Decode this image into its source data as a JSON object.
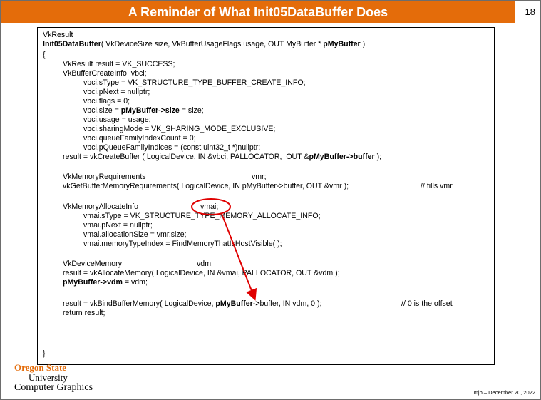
{
  "slide": {
    "title": "A Reminder of What Init05DataBuffer Does",
    "page_number": "18",
    "footer": "mjb – December 20, 2022",
    "logo": {
      "line1": "Oregon State",
      "line2": "University",
      "line3": "Computer Graphics"
    }
  },
  "code": {
    "l1": "VkResult",
    "l2a": "Init05DataBuffer",
    "l2b": "( VkDeviceSize size, VkBufferUsageFlags usage, OUT MyBuffer * ",
    "l2c": "pMyBuffer",
    "l2d": " )",
    "l3": "{",
    "l4": "VkResult result = VK_SUCCESS;",
    "l5": "VkBufferCreateInfo  vbci;",
    "l6": "vbci.sType = VK_STRUCTURE_TYPE_BUFFER_CREATE_INFO;",
    "l7": "vbci.pNext = nullptr;",
    "l8": "vbci.flags = 0;",
    "l9a": "vbci.size = ",
    "l9b": "pMyBuffer->size",
    "l9c": " = size;",
    "l10": "vbci.usage = usage;",
    "l11": "vbci.sharingMode = VK_SHARING_MODE_EXCLUSIVE;",
    "l12": "vbci.queueFamilyIndexCount = 0;",
    "l13": "vbci.pQueueFamilyIndices = (const uint32_t *)nullptr;",
    "l14a": "result = vkCreateBuffer ( LogicalDevice, IN &vbci, PALLOCATOR,  OUT &",
    "l14b": "pMyBuffer->buffer",
    "l14c": " );",
    "l15a": "VkMemoryRequirements",
    "l15b": "vmr;",
    "l16a": "vkGetBufferMemoryRequirements( LogicalDevice, IN pMyBuffer->buffer, OUT &vmr );",
    "l16b": "// fills vmr",
    "l17a": "VkMemoryAllocateInfo",
    "l17b": "vmai;",
    "l18": "vmai.sType = VK_STRUCTURE_TYPE_MEMORY_ALLOCATE_INFO;",
    "l19": "vmai.pNext = nullptr;",
    "l20": "vmai.allocationSize = vmr.size;",
    "l21": "vmai.memoryTypeIndex = FindMemoryThatIsHostVisible( );",
    "l22a": "VkDeviceMemory",
    "l22b": "vdm;",
    "l23": "result = vkAllocateMemory( LogicalDevice, IN &vmai, PALLOCATOR, OUT &vdm );",
    "l24a": "pMyBuffer->vdm",
    "l24b": " = vdm;",
    "l25a": "result = vkBindBufferMemory( LogicalDevice, ",
    "l25b": "pMyBuffer->",
    "l25c": "buffer, IN vdm, 0 );",
    "l25d": "// 0 is the offset",
    "l26": "return result;",
    "l27": "}"
  },
  "annotation": {
    "color": "#e00000"
  },
  "colors": {
    "title_bar": "#e46c0a",
    "title_text": "#ffffff",
    "logo_accent": "#e46c0a"
  }
}
